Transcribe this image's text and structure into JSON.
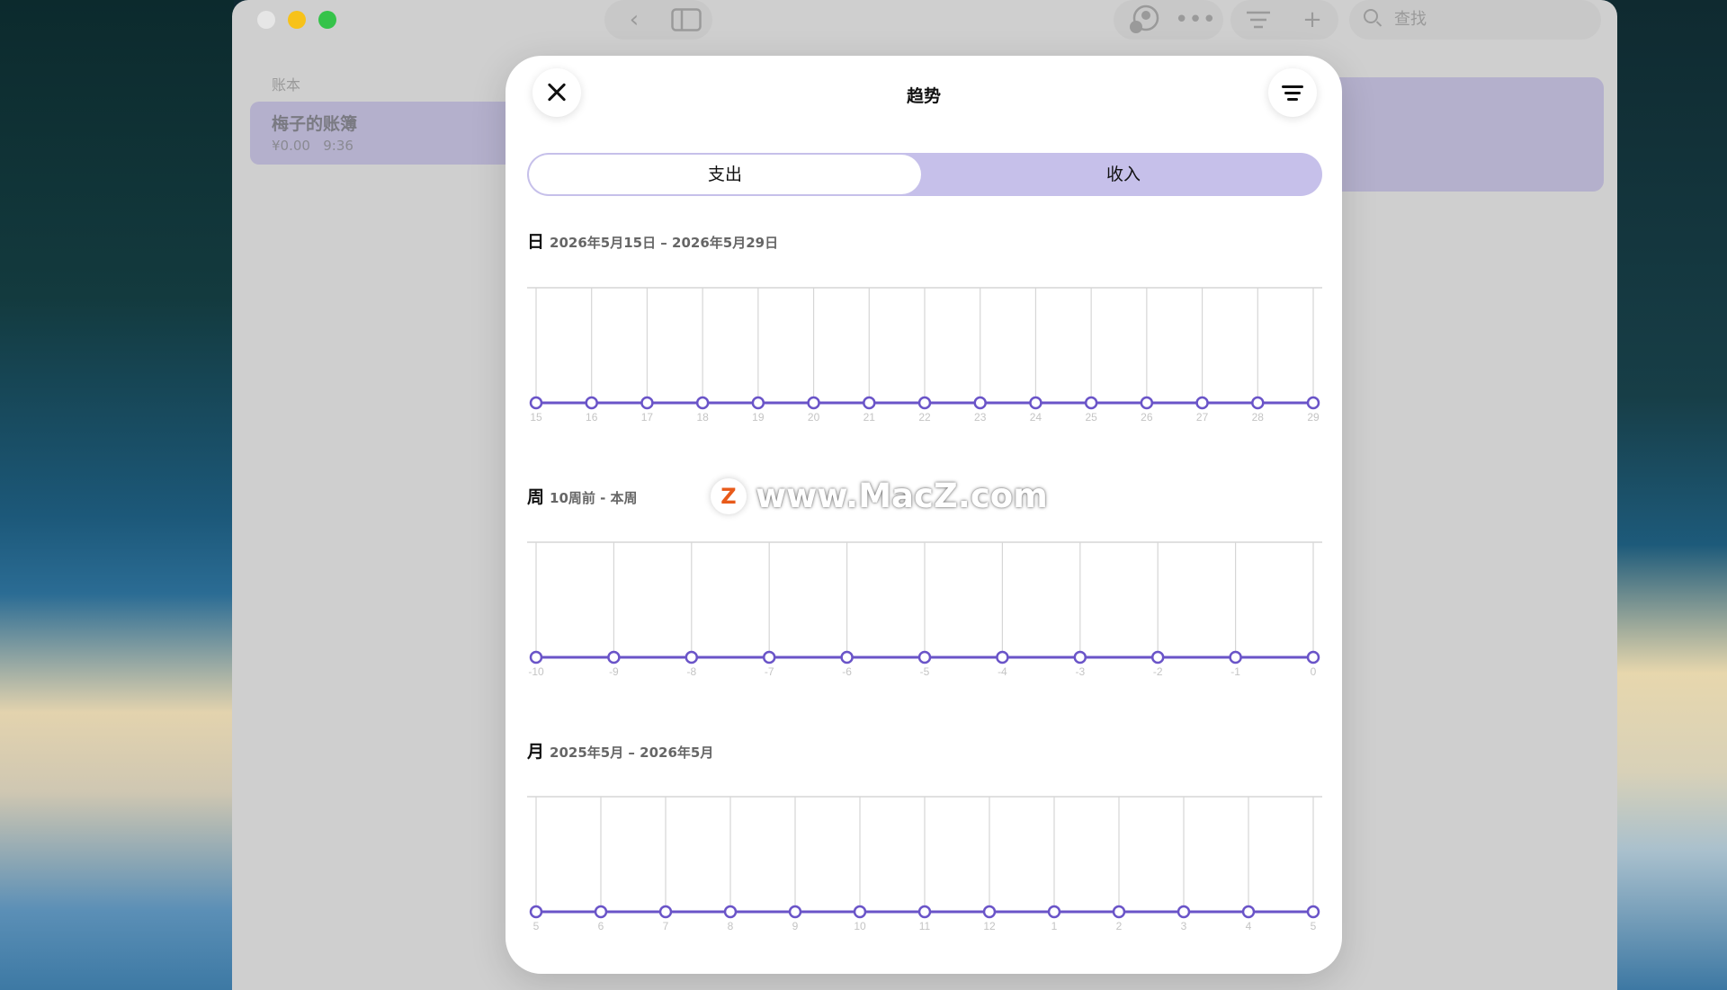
{
  "window": {
    "search_placeholder": "查找",
    "sidebar_header": "账本",
    "ledger": {
      "name": "梅子的账簿",
      "balance": "¥0.00",
      "time": "9:36"
    }
  },
  "modal": {
    "title": "趋势",
    "tabs": [
      {
        "label": "支出",
        "selected": true
      },
      {
        "label": "收入",
        "selected": false
      }
    ]
  },
  "sections": [
    {
      "title": "日",
      "range": "2026年5月15日 – 2026年5月29日"
    },
    {
      "title": "周",
      "range": "10周前 - 本周"
    },
    {
      "title": "月",
      "range": "2025年5月 – 2026年5月"
    }
  ],
  "watermark": {
    "logo": "Z",
    "text": "www.MacZ.com"
  },
  "colors": {
    "accent": "#6a54c8",
    "segment_bg": "#c6c0ea",
    "sidebar_selected": "#b4b0cc"
  },
  "chart_data": [
    {
      "type": "line",
      "categories": [
        "15",
        "16",
        "17",
        "18",
        "19",
        "20",
        "21",
        "22",
        "23",
        "24",
        "25",
        "26",
        "27",
        "28",
        "29"
      ],
      "values": [
        0,
        0,
        0,
        0,
        0,
        0,
        0,
        0,
        0,
        0,
        0,
        0,
        0,
        0,
        0
      ]
    },
    {
      "type": "line",
      "categories": [
        "-10",
        "-9",
        "-8",
        "-7",
        "-6",
        "-5",
        "-4",
        "-3",
        "-2",
        "-1",
        "0"
      ],
      "values": [
        0,
        0,
        0,
        0,
        0,
        0,
        0,
        0,
        0,
        0,
        0
      ]
    },
    {
      "type": "line",
      "categories": [
        "5",
        "6",
        "7",
        "8",
        "9",
        "10",
        "11",
        "12",
        "1",
        "2",
        "3",
        "4",
        "5"
      ],
      "values": [
        0,
        0,
        0,
        0,
        0,
        0,
        0,
        0,
        0,
        0,
        0,
        0,
        0
      ]
    }
  ]
}
